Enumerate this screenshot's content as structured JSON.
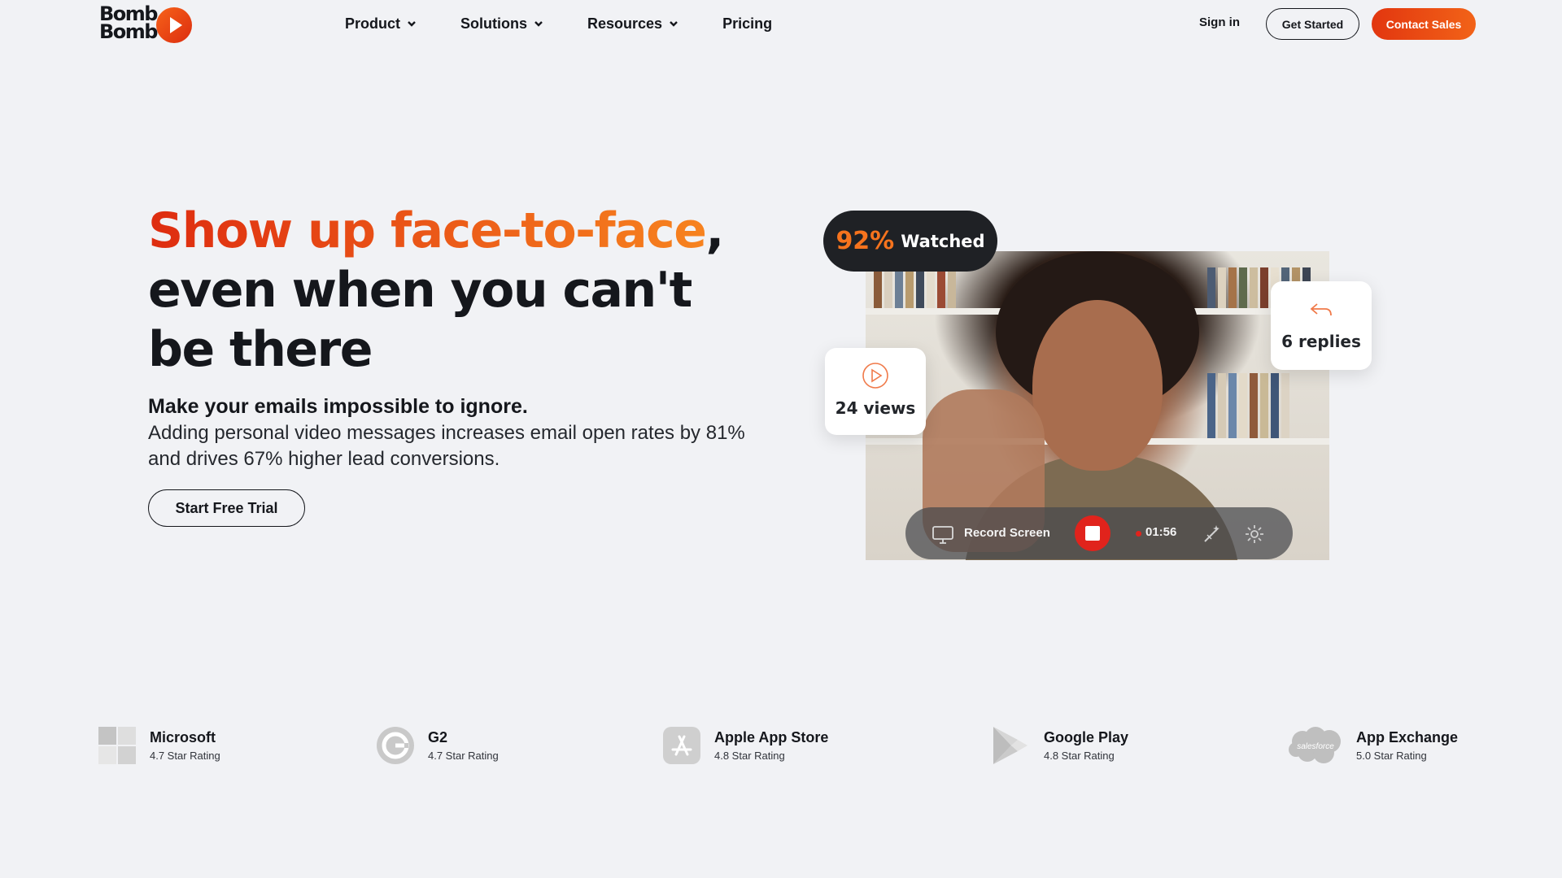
{
  "brand": {
    "logo_text_line1": "Bomb",
    "logo_text_line2": "Bomb",
    "accent": "#ee4c14",
    "accent_light": "#f7831f"
  },
  "nav": {
    "items": [
      {
        "label": "Product",
        "has_dropdown": true
      },
      {
        "label": "Solutions",
        "has_dropdown": true
      },
      {
        "label": "Resources",
        "has_dropdown": true
      },
      {
        "label": "Pricing",
        "has_dropdown": false
      }
    ],
    "sign_in": "Sign in",
    "get_started": "Get Started",
    "contact_sales": "Contact Sales"
  },
  "hero": {
    "headline_highlight": "Show up face-to-face",
    "headline_comma": ",",
    "headline_rest": "even when you can't be there",
    "subheadline": "Make your emails impossible to ignore.",
    "body": "Adding personal video messages increases email open rates by 81% and drives 67% higher lead conversions.",
    "cta": "Start Free Trial"
  },
  "video_card": {
    "watched_percent": "92%",
    "watched_label": "Watched",
    "views": "24 views",
    "replies": "6 replies",
    "record_label": "Record Screen",
    "timer": "01:56"
  },
  "ratings": [
    {
      "name": "Microsoft",
      "rating": "4.7 Star Rating",
      "icon": "microsoft-icon"
    },
    {
      "name": "G2",
      "rating": "4.7 Star Rating",
      "icon": "g2-icon"
    },
    {
      "name": "Apple App Store",
      "rating": "4.8 Star Rating",
      "icon": "app-store-icon"
    },
    {
      "name": "Google Play",
      "rating": "4.8 Star Rating",
      "icon": "google-play-icon"
    },
    {
      "name": "App Exchange",
      "rating": "5.0 Star Rating",
      "icon": "salesforce-icon",
      "icon_text": "salesforce"
    }
  ]
}
